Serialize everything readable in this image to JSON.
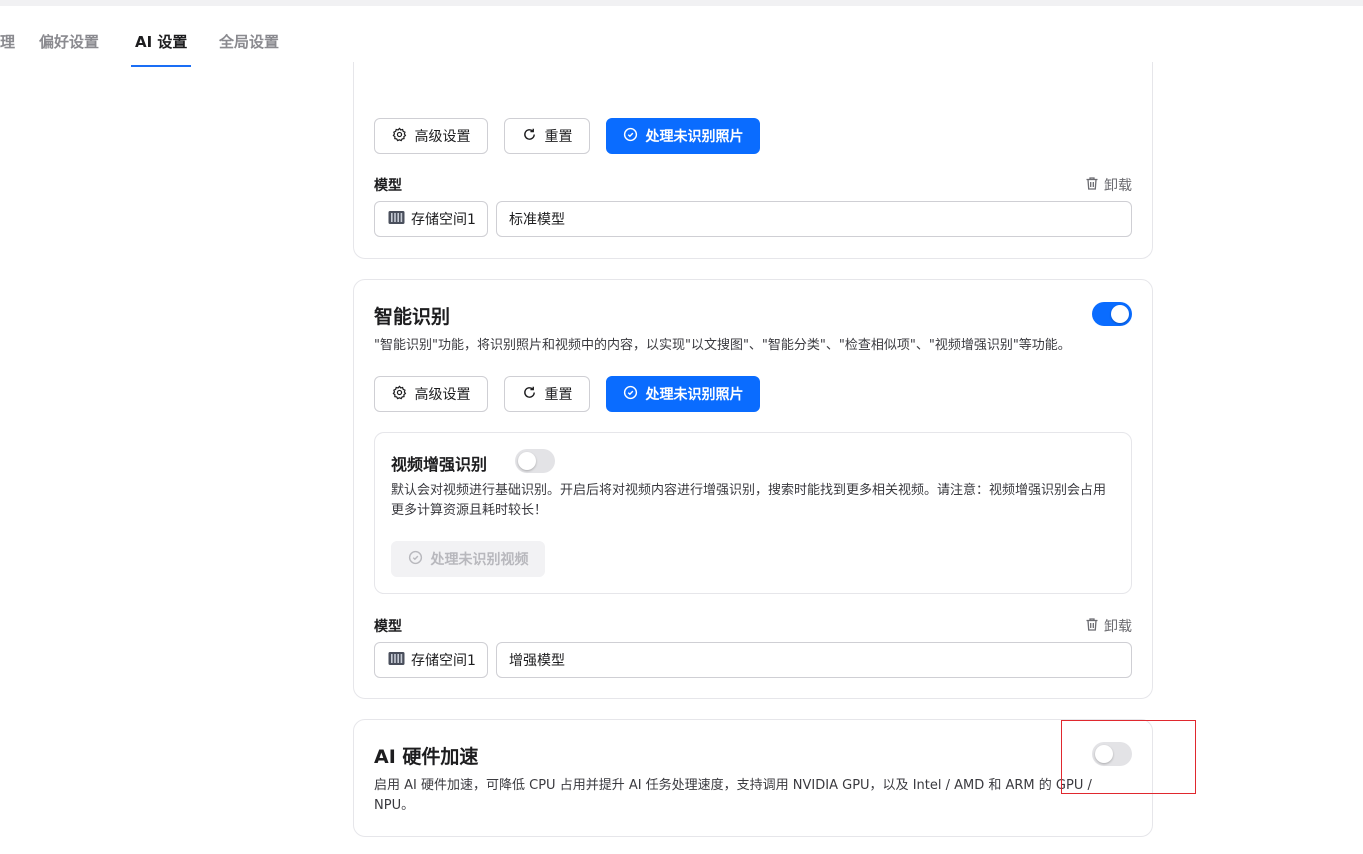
{
  "tabs": [
    {
      "label": "理"
    },
    {
      "label": "偏好设置"
    },
    {
      "label": "AI 设置"
    },
    {
      "label": "全局设置"
    }
  ],
  "face_section": {
    "advanced_label": "高级设置",
    "reset_label": "重置",
    "process_label": "处理未识别照片",
    "model_label": "模型",
    "unload_label": "卸载",
    "storage_label": "存储空间1",
    "model_value": "标准模型"
  },
  "smart_section": {
    "title": "智能识别",
    "enabled": true,
    "description": "\"智能识别\"功能，将识别照片和视频中的内容，以实现\"以文搜图\"、\"智能分类\"、\"检查相似项\"、\"视频增强识别\"等功能。",
    "advanced_label": "高级设置",
    "reset_label": "重置",
    "process_label": "处理未识别照片",
    "video": {
      "title": "视频增强识别",
      "enabled": false,
      "description": "默认会对视频进行基础识别。开启后将对视频内容进行增强识别，搜索时能找到更多相关视频。请注意：视频增强识别会占用更多计算资源且耗时较长！",
      "process_label": "处理未识别视频"
    },
    "model_label": "模型",
    "unload_label": "卸载",
    "storage_label": "存储空间1",
    "model_value": "增强模型"
  },
  "hw_section": {
    "title": "AI 硬件加速",
    "enabled": false,
    "description": "启用 AI 硬件加速，可降低 CPU 占用并提升 AI 任务处理速度，支持调用 NVIDIA GPU，以及 Intel / AMD 和 ARM 的 GPU / NPU。"
  },
  "icons": [
    "gear-icon",
    "refresh-icon",
    "check-circle-icon",
    "trash-icon",
    "storage-icon"
  ],
  "colors": {
    "accent": "#0a6cff",
    "highlight": "#e0282e"
  }
}
